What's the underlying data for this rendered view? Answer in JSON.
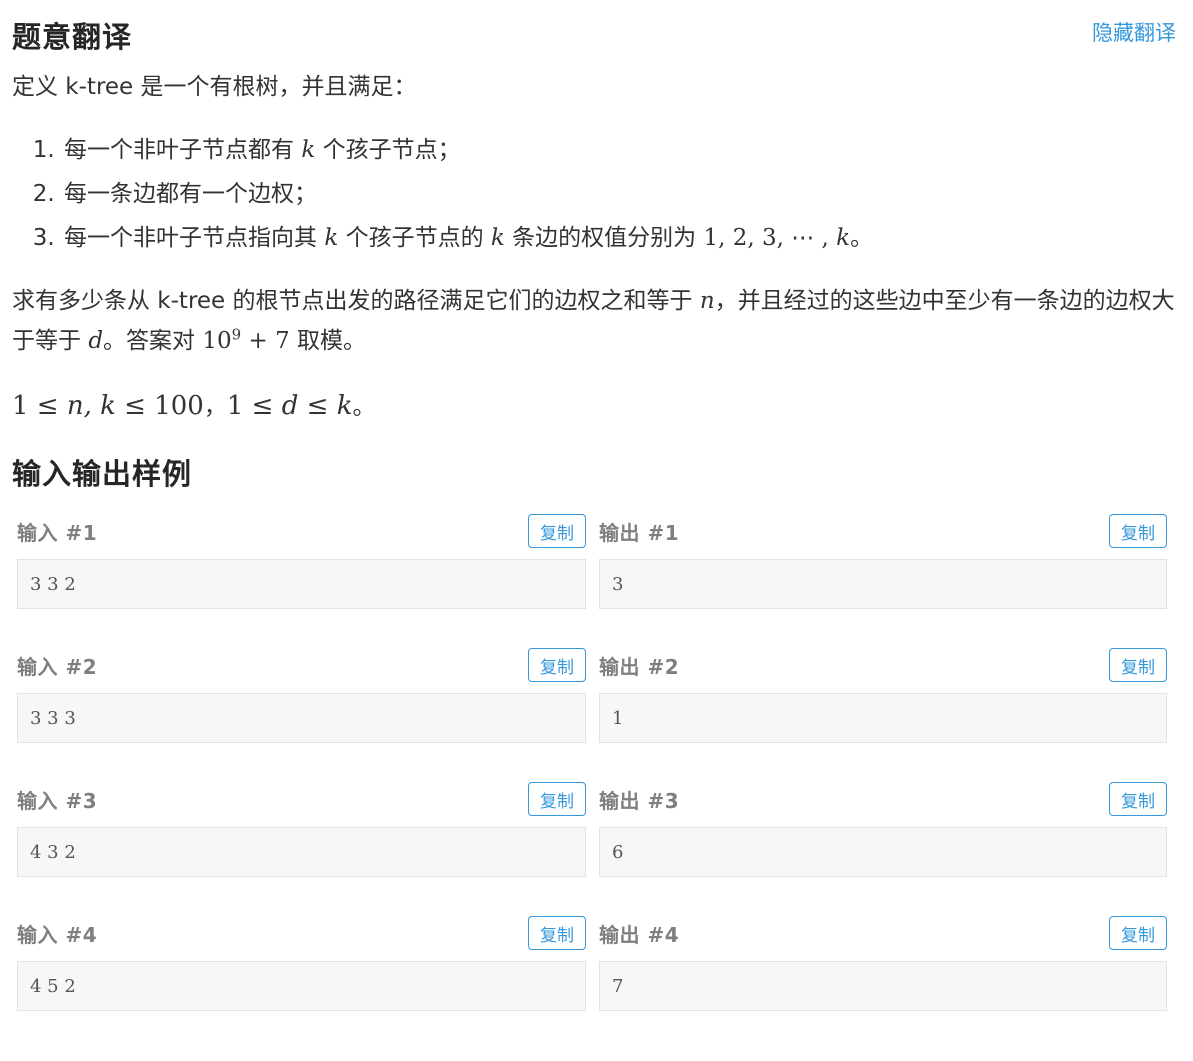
{
  "translation": {
    "title": "题意翻译",
    "hide_link": "隐藏翻译",
    "definition": "定义 k-tree 是一个有根树，并且满足：",
    "rules": [
      {
        "pre": "每一个非叶子节点都有",
        "k1": "k",
        "post": "个孩子节点；"
      },
      {
        "text": "每一条边都有一个边权；"
      },
      {
        "pre": "每一个非叶子节点指向其",
        "k1": "k",
        "mid": "个孩子节点的",
        "k2": "k",
        "mid2": "条边的权值分别为",
        "seq": "1, 2, 3, ⋯ , ",
        "k3": "k",
        "post": "。"
      }
    ],
    "question": {
      "p1": "求有多少条从 k-tree 的根节点出发的路径满足它们的边权之和等于",
      "n": "n",
      "p2": "，并且经过的这些边中至少有一条边的边权大于等于",
      "d": "d",
      "p3": "。答案对",
      "base": "10",
      "exp": "9",
      "plus": " + 7",
      "p4": "取模。"
    },
    "constraints": {
      "c1_lead": "1 ≤ ",
      "c1_vars": "n, k",
      "c1_tail": " ≤ 100",
      "sep": "，",
      "c2_lead": "1 ≤ ",
      "c2_var": "d",
      "c2_mid": " ≤ ",
      "c2_var2": "k",
      "end": "。"
    }
  },
  "samples": {
    "title": "输入输出样例",
    "copy_label": "复制",
    "items": [
      {
        "in_label": "输入 #1",
        "in": "3 3 2",
        "out_label": "输出 #1",
        "out": "3"
      },
      {
        "in_label": "输入 #2",
        "in": "3 3 3",
        "out_label": "输出 #2",
        "out": "1"
      },
      {
        "in_label": "输入 #3",
        "in": "4 3 2",
        "out_label": "输出 #3",
        "out": "6"
      },
      {
        "in_label": "输入 #4",
        "in": "4 5 2",
        "out_label": "输出 #4",
        "out": "7"
      }
    ]
  },
  "colors": {
    "accent": "#3498db",
    "label_gray": "#7f7f7f",
    "box_bg": "#f7f7f7"
  }
}
